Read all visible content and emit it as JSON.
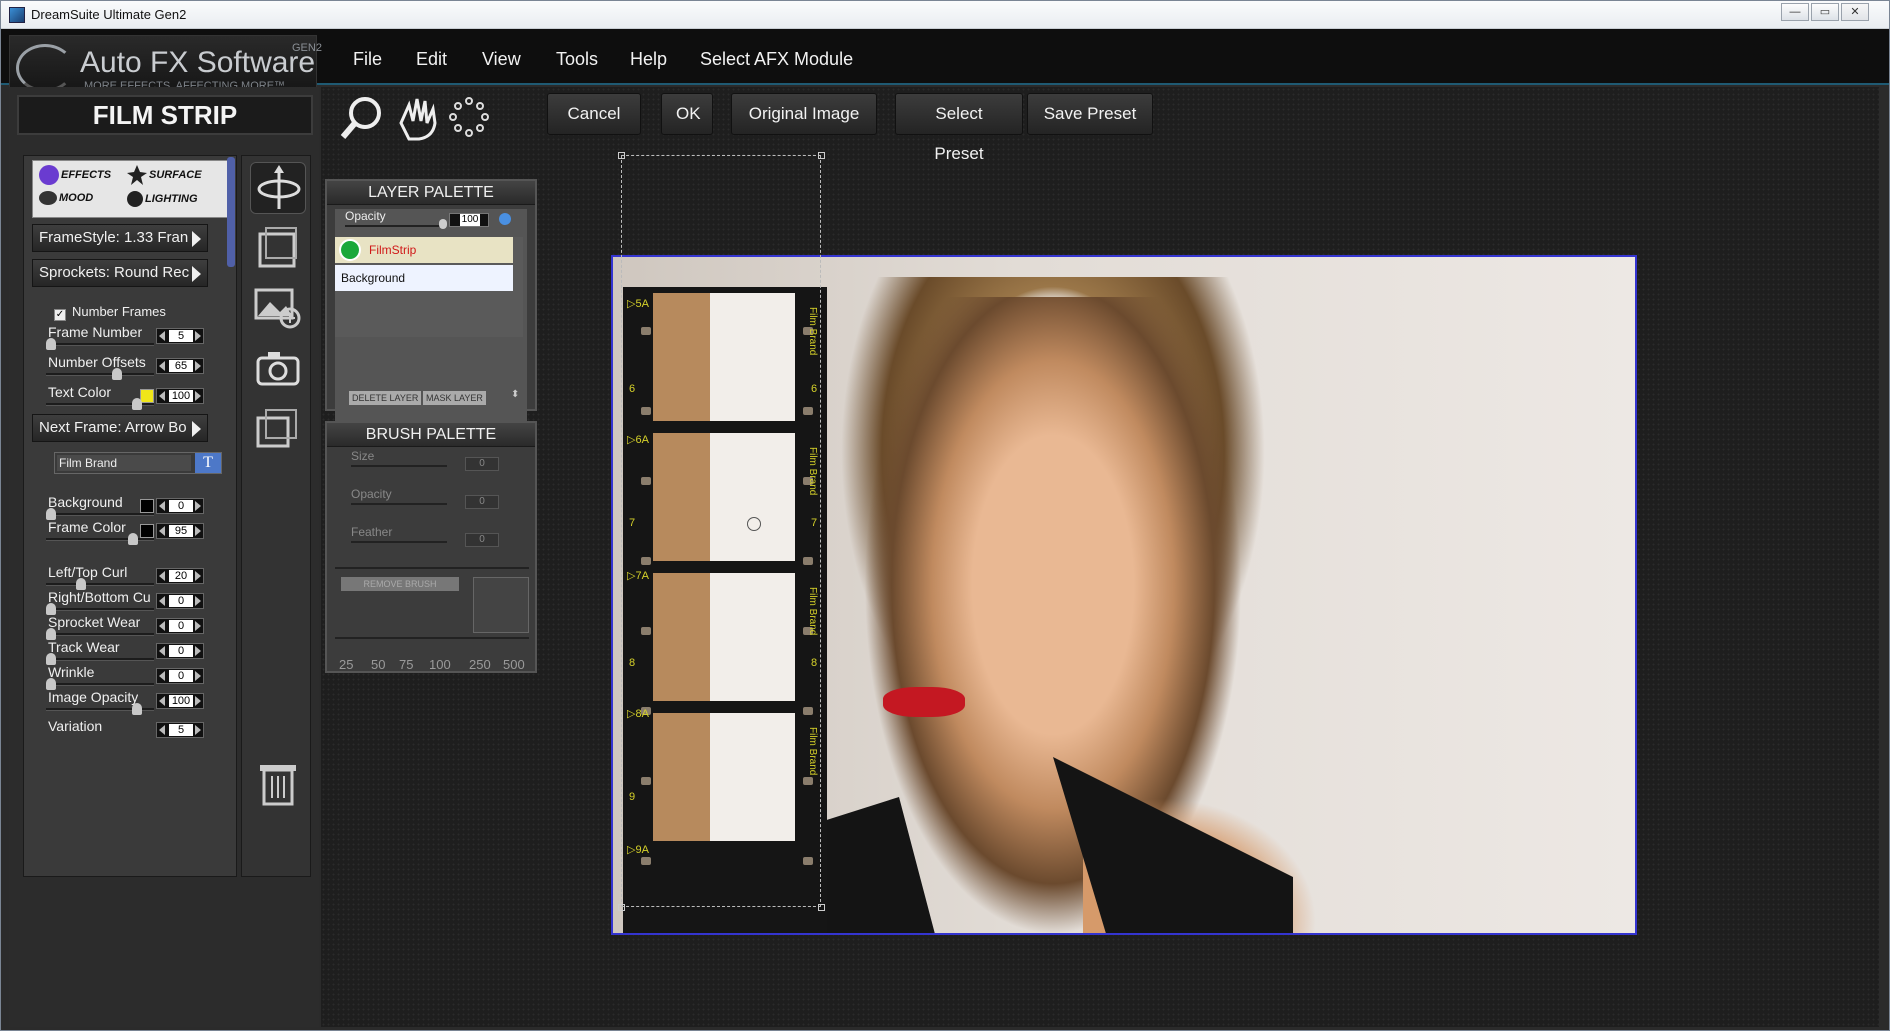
{
  "window": {
    "title": "DreamSuite Ultimate Gen2",
    "min": "—",
    "max": "▭",
    "close": "✕"
  },
  "logo": {
    "brand": "Auto FX Software",
    "tagline": "MORE EFFECTS. AFFECTING MORE™",
    "gen": "GEN2"
  },
  "menu": [
    "File",
    "Edit",
    "View",
    "Tools",
    "Help",
    "Select AFX Module"
  ],
  "panel": {
    "title": "FILM STRIP"
  },
  "tabs": {
    "effects": "EFFECTS",
    "surface": "SURFACE",
    "mood": "MOOD",
    "lighting": "LIGHTING"
  },
  "dropdowns": {
    "framestyle": "FrameStyle: 1.33 Fran",
    "sprockets": "Sprockets: Round Rec",
    "nextframe": "Next Frame: Arrow Bo"
  },
  "number_frames": {
    "label": "Number Frames",
    "checked": true,
    "mark": "✓"
  },
  "sliders": [
    {
      "label": "Frame Number",
      "value": "5"
    },
    {
      "label": "Number Offsets",
      "value": "65"
    },
    {
      "label": "Text Color",
      "value": "100",
      "swatch": "#f0e61a"
    },
    {
      "label": "Background",
      "value": "0",
      "swatch": "#000000"
    },
    {
      "label": "Frame Color",
      "value": "95",
      "swatch": "#000000"
    },
    {
      "label": "Left/Top Curl",
      "value": "20"
    },
    {
      "label": "Right/Bottom Cu",
      "value": "0"
    },
    {
      "label": "Sprocket Wear",
      "value": "0"
    },
    {
      "label": "Track Wear",
      "value": "0"
    },
    {
      "label": "Wrinkle",
      "value": "0"
    },
    {
      "label": "Image Opacity",
      "value": "100"
    },
    {
      "label": "Variation",
      "value": "5"
    }
  ],
  "text_field": {
    "value": "Film Brand",
    "button": "T"
  },
  "toolbar": {
    "cancel": "Cancel",
    "ok": "OK",
    "original": "Original Image",
    "select_preset": "Select Preset",
    "save_preset": "Save Preset"
  },
  "layer_palette": {
    "title": "LAYER PALETTE",
    "opacity_label": "Opacity",
    "opacity_value": "100",
    "layers": [
      "FilmStrip",
      "Background"
    ],
    "delete": "DELETE LAYER",
    "mask": "MASK LAYER"
  },
  "brush_palette": {
    "title": "BRUSH PALETTE",
    "size_label": "Size",
    "size_value": "0",
    "opacity_label": "Opacity",
    "opacity_value": "0",
    "feather_label": "Feather",
    "feather_value": "0",
    "remove": "REMOVE BRUSH",
    "sizes": [
      "25",
      "50",
      "75",
      "100",
      "250",
      "500"
    ]
  },
  "filmstrip_text": {
    "brand": "Film Brand",
    "left_numbers": [
      "▷5A",
      "6",
      "▷6A",
      "7",
      "▷7A",
      "8",
      "▷8A",
      "9",
      "▷9A"
    ],
    "right_numbers": [
      "6",
      "7",
      "8"
    ]
  },
  "colors": {
    "accent": "#1f5a73",
    "selection": "#3434d0",
    "ylw": "#d6d22a",
    "layer_active": "#d01818"
  }
}
